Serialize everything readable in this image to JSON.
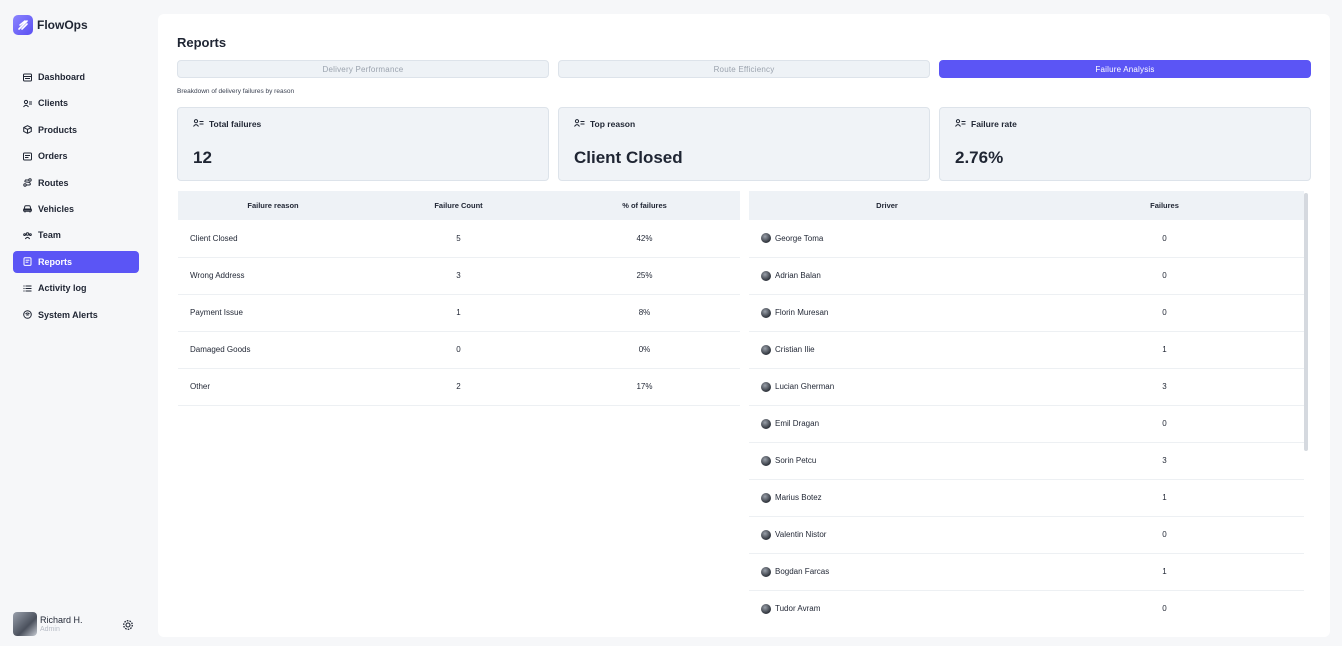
{
  "app": {
    "name": "FlowOps"
  },
  "sidebar": {
    "items": [
      {
        "label": "Dashboard",
        "icon": "dashboard-icon",
        "active": false
      },
      {
        "label": "Clients",
        "icon": "clients-icon",
        "active": false
      },
      {
        "label": "Products",
        "icon": "products-icon",
        "active": false
      },
      {
        "label": "Orders",
        "icon": "orders-icon",
        "active": false
      },
      {
        "label": "Routes",
        "icon": "routes-icon",
        "active": false
      },
      {
        "label": "Vehicles",
        "icon": "vehicle-icon",
        "active": false
      },
      {
        "label": "Team",
        "icon": "team-icon",
        "active": false
      },
      {
        "label": "Reports",
        "icon": "reports-icon",
        "active": true
      },
      {
        "label": "Activity log",
        "icon": "list-icon",
        "active": false
      },
      {
        "label": "System Alerts",
        "icon": "alerts-icon",
        "active": false
      }
    ]
  },
  "user": {
    "name": "Richard H.",
    "role": "Admin"
  },
  "page": {
    "title": "Reports",
    "subtitle": "Breakdown of delivery failures by reason"
  },
  "tabs": [
    {
      "label": "Delivery Performance",
      "active": false
    },
    {
      "label": "Route Efficiency",
      "active": false
    },
    {
      "label": "Failure Analysis",
      "active": true
    }
  ],
  "cards": [
    {
      "label": "Total failures",
      "value": "12"
    },
    {
      "label": "Top reason",
      "value": "Client Closed"
    },
    {
      "label": "Failure rate",
      "value": "2.76%"
    }
  ],
  "reasons_table": {
    "headers": [
      "Failure reason",
      "Failure Count",
      "% of failures"
    ],
    "rows": [
      [
        "Client Closed",
        "5",
        "42%"
      ],
      [
        "Wrong Address",
        "3",
        "25%"
      ],
      [
        "Payment Issue",
        "1",
        "8%"
      ],
      [
        "Damaged Goods",
        "0",
        "0%"
      ],
      [
        "Other",
        "2",
        "17%"
      ]
    ]
  },
  "drivers_table": {
    "headers": [
      "Driver",
      "Failures"
    ],
    "rows": [
      [
        "George Toma",
        "0"
      ],
      [
        "Adrian Balan",
        "0"
      ],
      [
        "Florin Muresan",
        "0"
      ],
      [
        "Cristian Ilie",
        "1"
      ],
      [
        "Lucian Gherman",
        "3"
      ],
      [
        "Emil Dragan",
        "0"
      ],
      [
        "Sorin Petcu",
        "3"
      ],
      [
        "Marius Botez",
        "1"
      ],
      [
        "Valentin Nistor",
        "0"
      ],
      [
        "Bogdan Farcas",
        "1"
      ],
      [
        "Tudor Avram",
        "0"
      ]
    ]
  },
  "colors": {
    "accent": "#5b55f5",
    "panel": "#eef2f6",
    "background": "#f6f7f9"
  }
}
